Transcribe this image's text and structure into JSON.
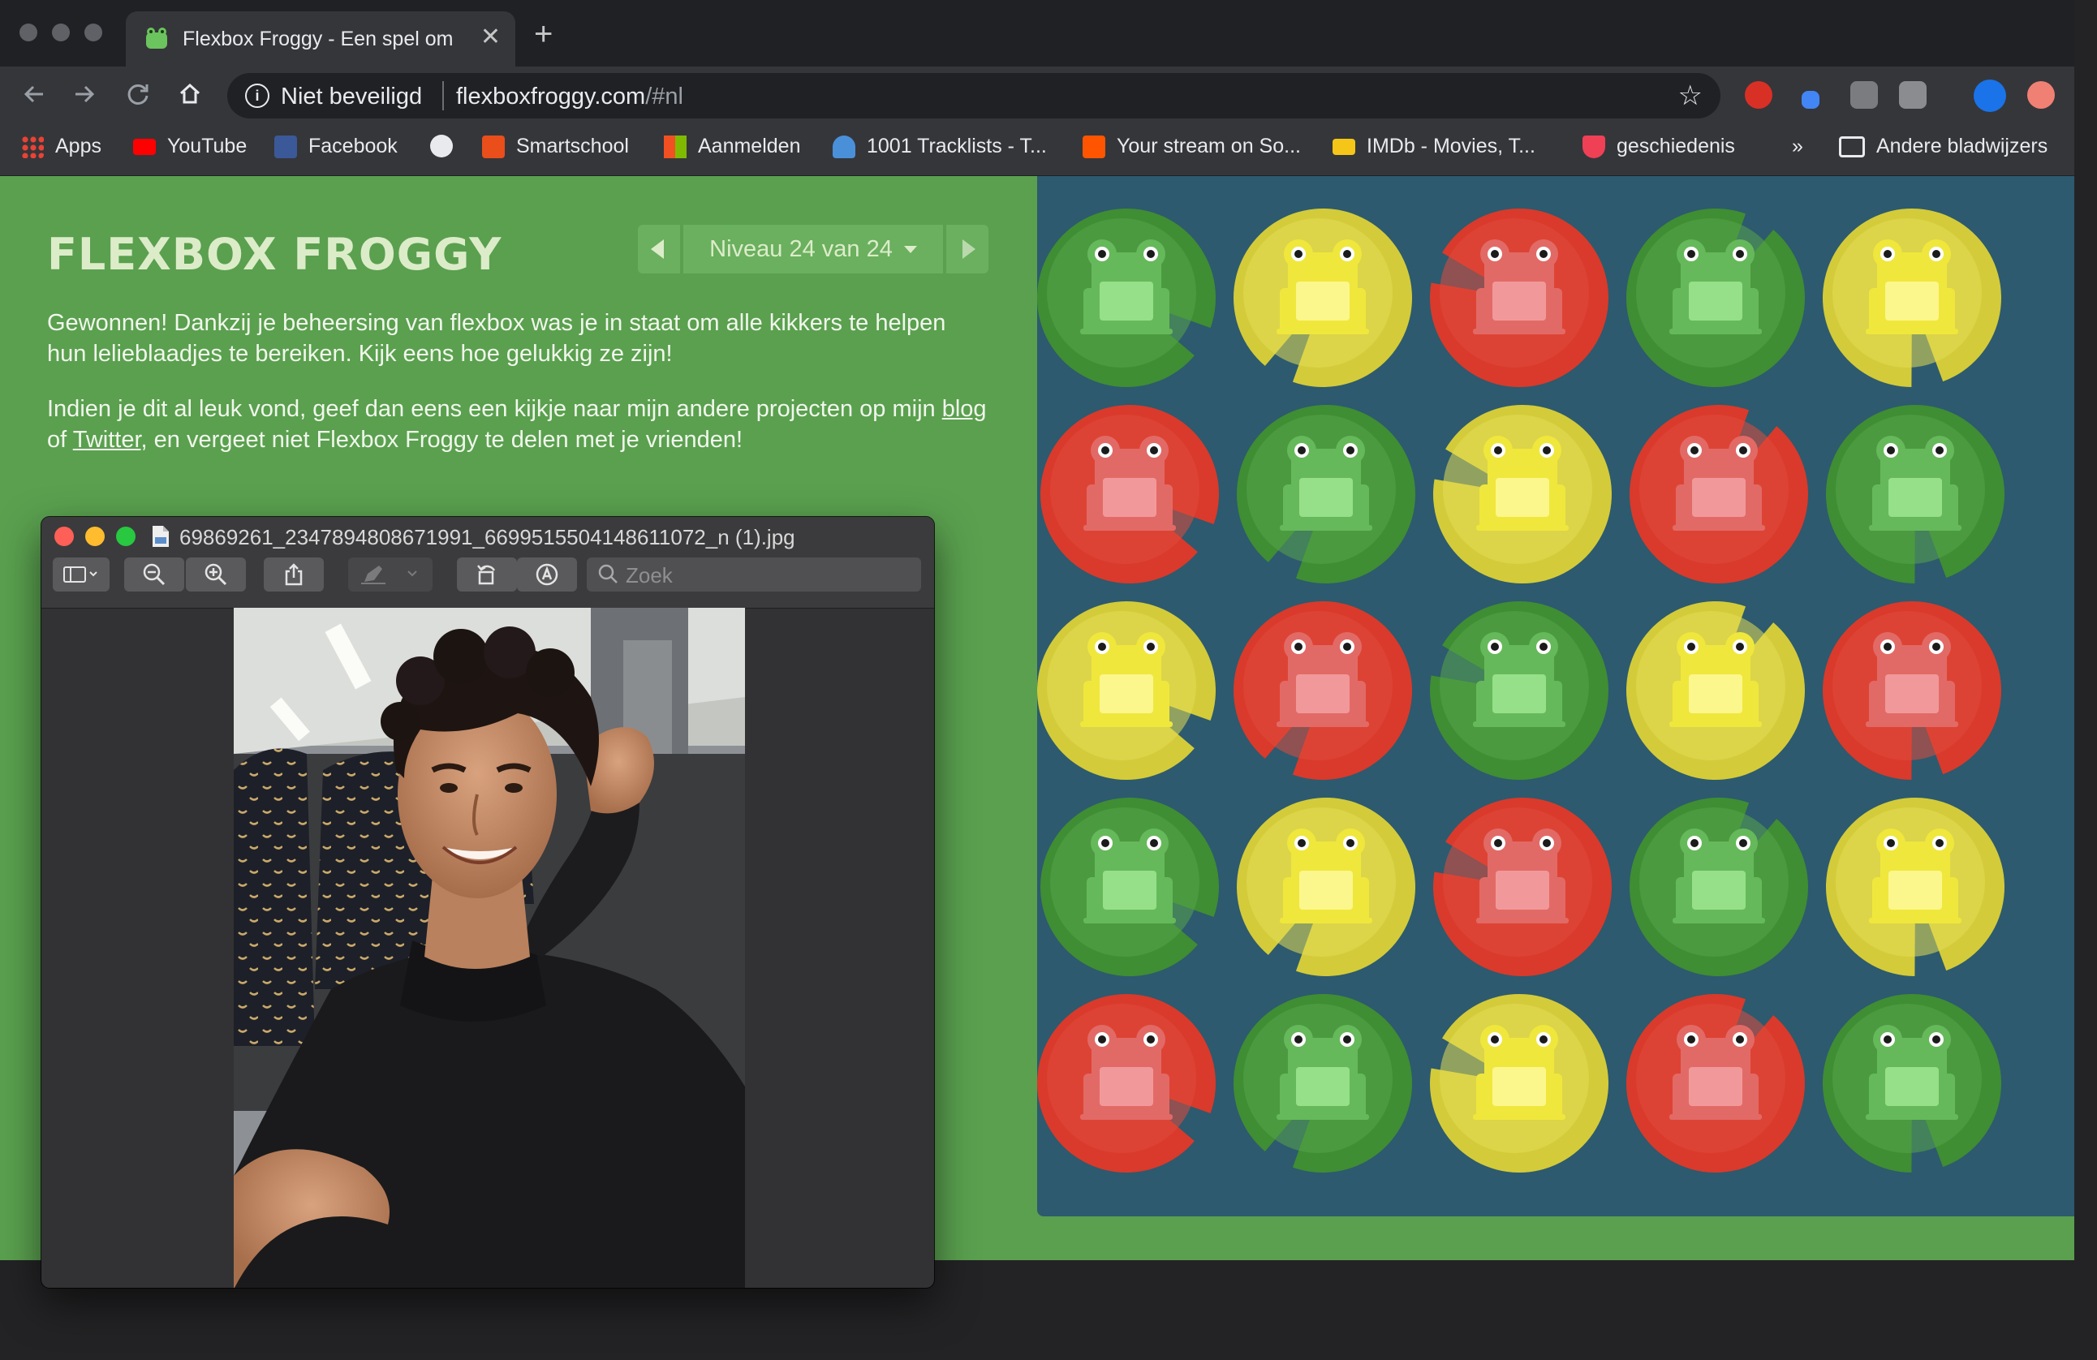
{
  "browser": {
    "tab_title": "Flexbox Froggy - Een spel om CSS flexbox te leren",
    "new_tab_label": "+",
    "close_label": "✕",
    "security_label": "Niet beveiligd",
    "url_domain": "flexboxfroggy.com",
    "url_path": "/#nl",
    "bookmarks": [
      {
        "label": "Apps",
        "icon": "apps-grid-icon",
        "color": "#e8453c"
      },
      {
        "label": "YouTube",
        "icon": "youtube-icon",
        "color": "#ff0000"
      },
      {
        "label": "Facebook",
        "icon": "facebook-icon",
        "color": "#1877f2"
      },
      {
        "label": "",
        "icon": "globe-icon",
        "color": "#e8eaed"
      },
      {
        "label": "Smartschool",
        "icon": "smartschool-icon",
        "color": "#e94e1b"
      },
      {
        "label": "Aanmelden",
        "icon": "microsoft-icon",
        "color": "#f25022"
      },
      {
        "label": "1001 Tracklists - T...",
        "icon": "headphones-icon",
        "color": "#4a90d9"
      },
      {
        "label": "Your stream on So...",
        "icon": "soundcloud-icon",
        "color": "#ff5500"
      },
      {
        "label": "IMDb - Movies, T...",
        "icon": "imdb-icon",
        "color": "#f5c518"
      },
      {
        "label": "geschiedenis",
        "icon": "pocket-icon",
        "color": "#ef4056"
      }
    ],
    "overflow_label": "»",
    "other_bookmarks_label": "Andere bladwijzers"
  },
  "game": {
    "title": "FLEXBOX FROGGY",
    "level_label": "Niveau 24 van 24",
    "win_message": "Gewonnen! Dankzij je beheersing van flexbox was je in staat om alle kikkers te helpen hun lelieblaadjes te bereiken. Kijk eens hoe gelukkig ze zijn!",
    "more_intro": "Indien je dit al leuk vond, geef dan eens een kijkje naar mijn andere projecten op mijn",
    "blog_link": "blog",
    "of_text": "of",
    "twitter_link": "Twitter",
    "more_outro": ", en vergeet niet Flexbox Froggy te delen met je vrienden!",
    "colors": {
      "green": "#3f8e33",
      "yellow": "#d3cb3a",
      "red": "#d93a2b",
      "board": "#2d5a6e",
      "page": "#5aa04f"
    },
    "grid": [
      [
        "green",
        "yellow",
        "red",
        "green",
        "yellow"
      ],
      [
        "red",
        "green",
        "yellow",
        "red",
        "green"
      ],
      [
        "yellow",
        "red",
        "green",
        "yellow",
        "red"
      ],
      [
        "green",
        "yellow",
        "red",
        "green",
        "yellow"
      ],
      [
        "red",
        "green",
        "yellow",
        "red",
        "green"
      ]
    ]
  },
  "preview": {
    "filename": "69869261_2347894808671991_6699515504148611072_n (1).jpg",
    "search_placeholder": "Zoek"
  }
}
